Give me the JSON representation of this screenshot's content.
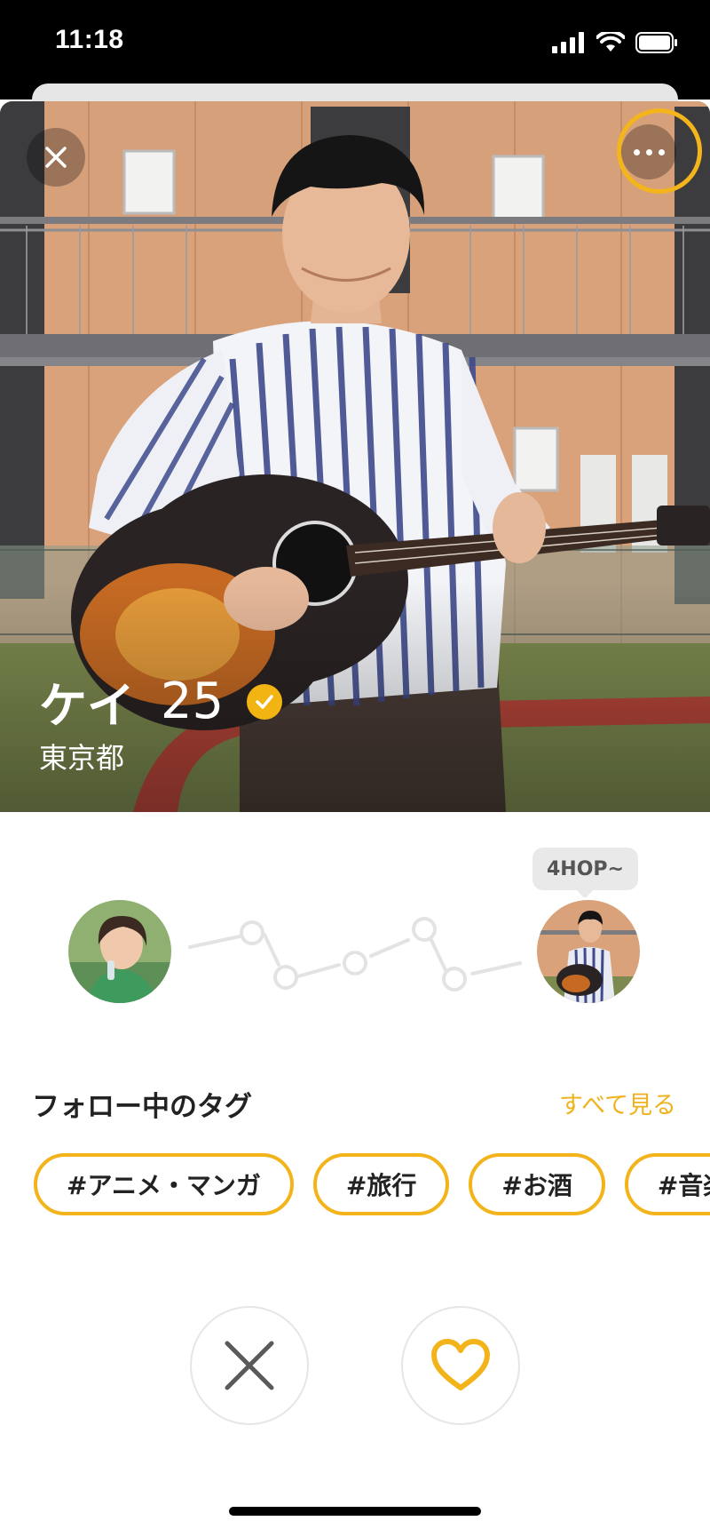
{
  "status_bar": {
    "time": "11:18"
  },
  "profile": {
    "name": "ケイ",
    "age": "25",
    "location": "東京都",
    "verified": true
  },
  "hop": {
    "badge": "4HOP~"
  },
  "tags_section": {
    "title": "フォロー中のタグ",
    "see_all": "すべて見る",
    "tags": [
      "#アニメ・マンガ",
      "#旅行",
      "#お酒",
      "#音楽"
    ]
  },
  "colors": {
    "accent": "#f2b41a",
    "hop_path": "#e3e3e3",
    "badge_bg": "#e9e9e9"
  },
  "icons": {
    "close": "close-icon",
    "more": "more-dots-icon",
    "verified": "check-badge-icon",
    "nope": "x-icon",
    "like": "heart-icon"
  }
}
